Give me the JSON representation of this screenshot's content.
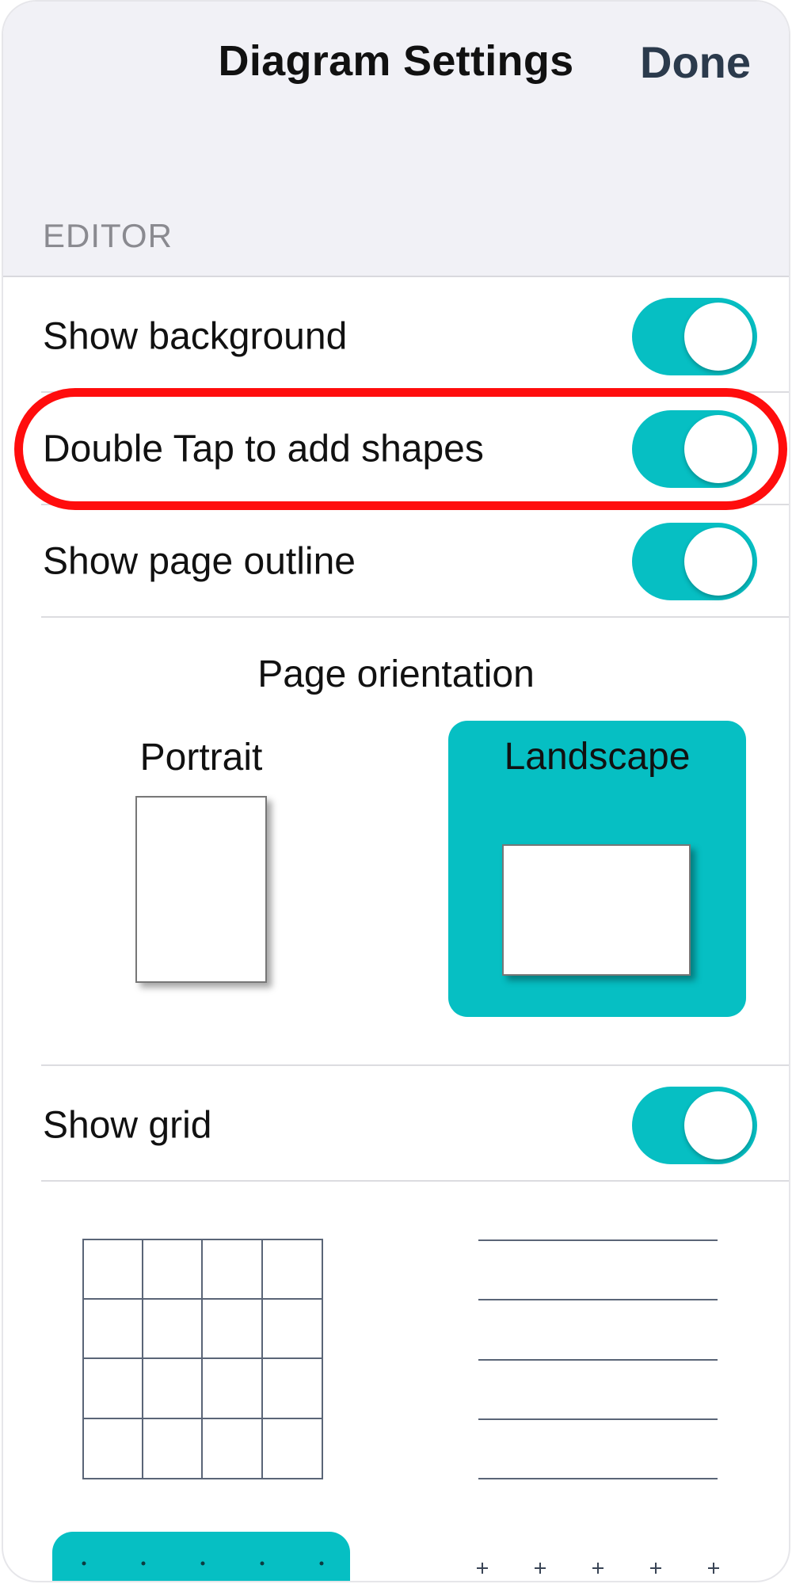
{
  "header": {
    "title": "Diagram Settings",
    "done_label": "Done"
  },
  "editor": {
    "section_label": "EDITOR",
    "toggles": [
      {
        "label": "Show background",
        "on": true
      },
      {
        "label": "Double Tap to add shapes",
        "on": true
      },
      {
        "label": "Show page outline",
        "on": true
      }
    ],
    "orientation": {
      "title": "Page orientation",
      "options": [
        {
          "label": "Portrait",
          "selected": false
        },
        {
          "label": "Landscape",
          "selected": true
        }
      ]
    },
    "grid": {
      "label": "Show grid",
      "on": true
    }
  },
  "colors": {
    "accent": "#06bfc3",
    "highlight": "#ff0d0d",
    "header_bg": "#f1f1f6",
    "grid_line": "#5a6577"
  }
}
